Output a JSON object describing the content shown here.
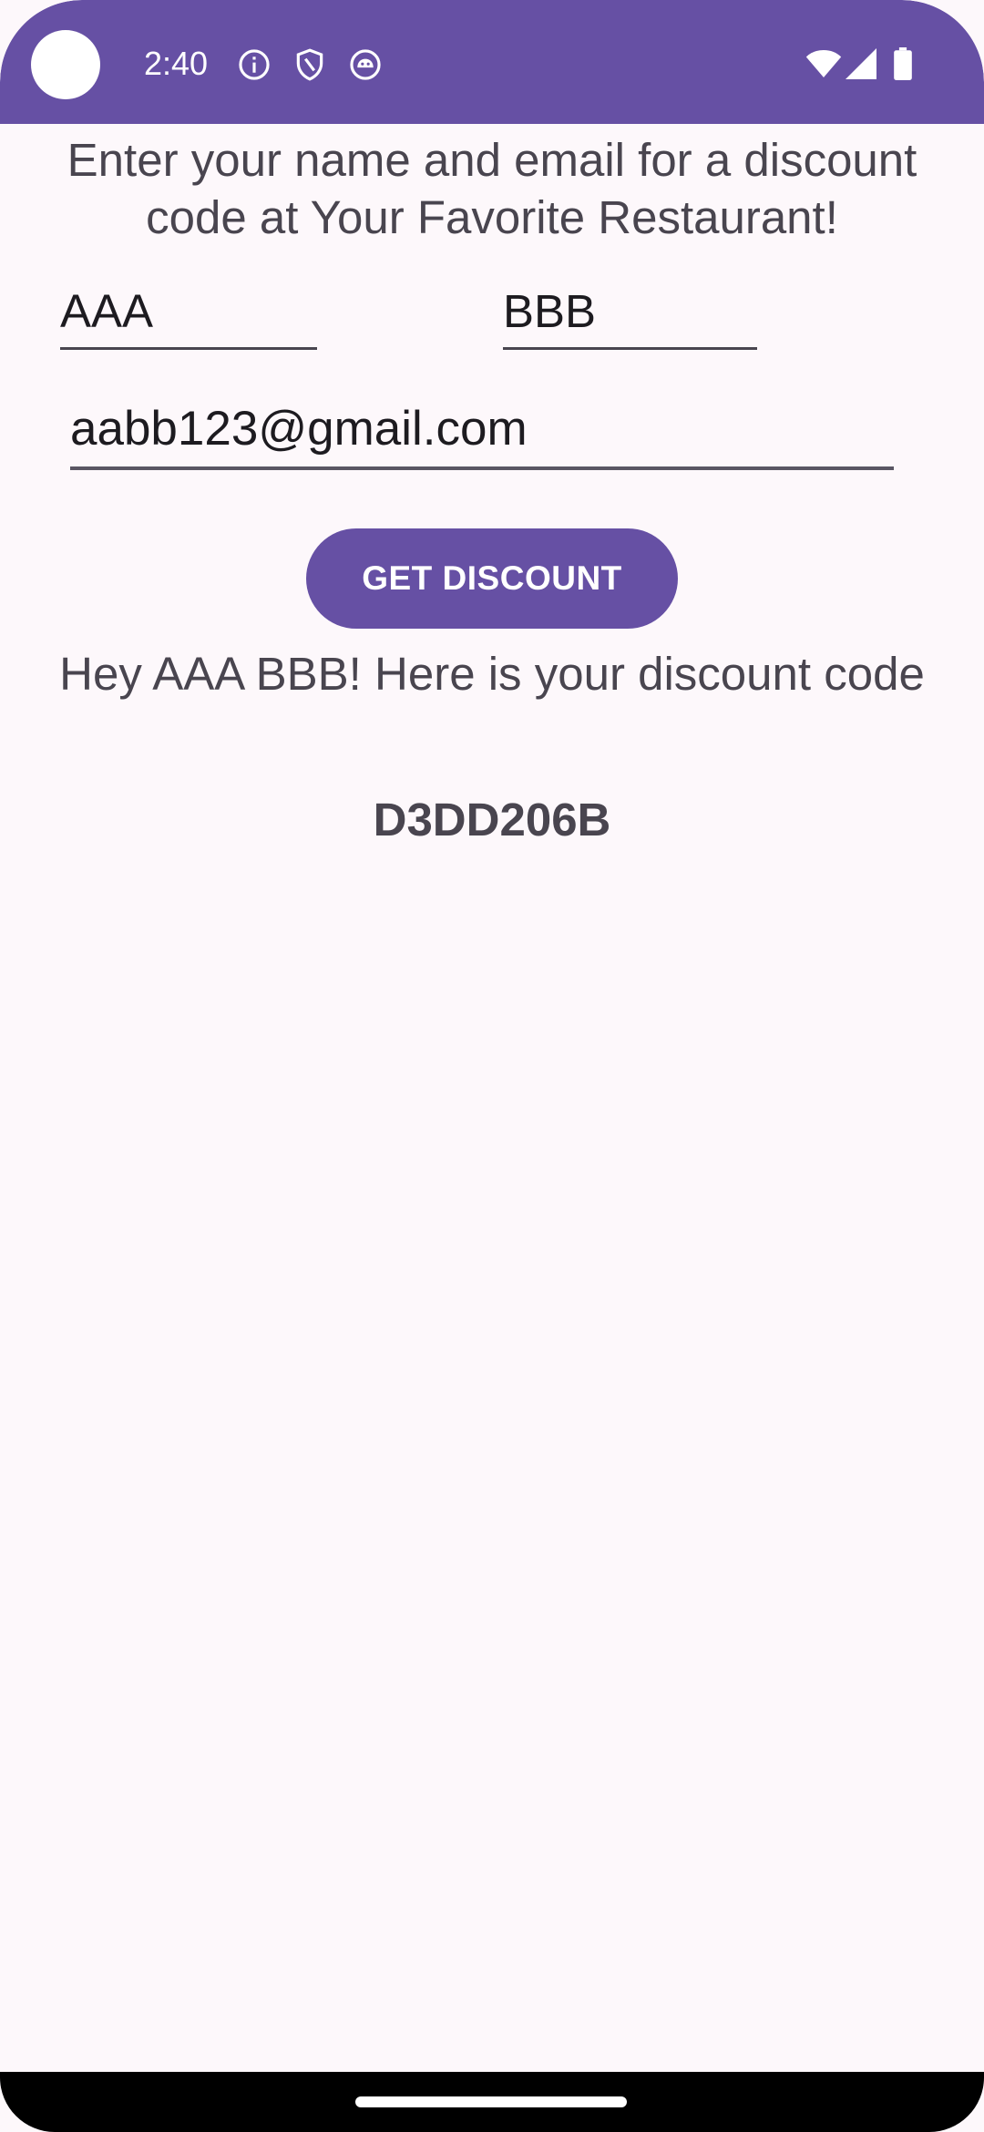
{
  "status_bar": {
    "time": "2:40",
    "notification_icons": [
      "info-icon",
      "shield-icon",
      "android-icon"
    ],
    "system_icons": [
      "wifi-icon",
      "signal-icon",
      "battery-icon"
    ],
    "background_color": "#6650a4"
  },
  "main": {
    "intro_text": "Enter your name and email for a discount code at Your Favorite Restaurant!",
    "first_name_value": "AAA",
    "last_name_value": "BBB",
    "email_value": "aabb123@gmail.com",
    "button_label": "GET DISCOUNT",
    "greeting_text": "Hey AAA BBB! Here is your discount code",
    "discount_code": "D3DD206B"
  },
  "colors": {
    "accent": "#6650a4",
    "background": "#fdf8fb",
    "text": "#49454f"
  }
}
